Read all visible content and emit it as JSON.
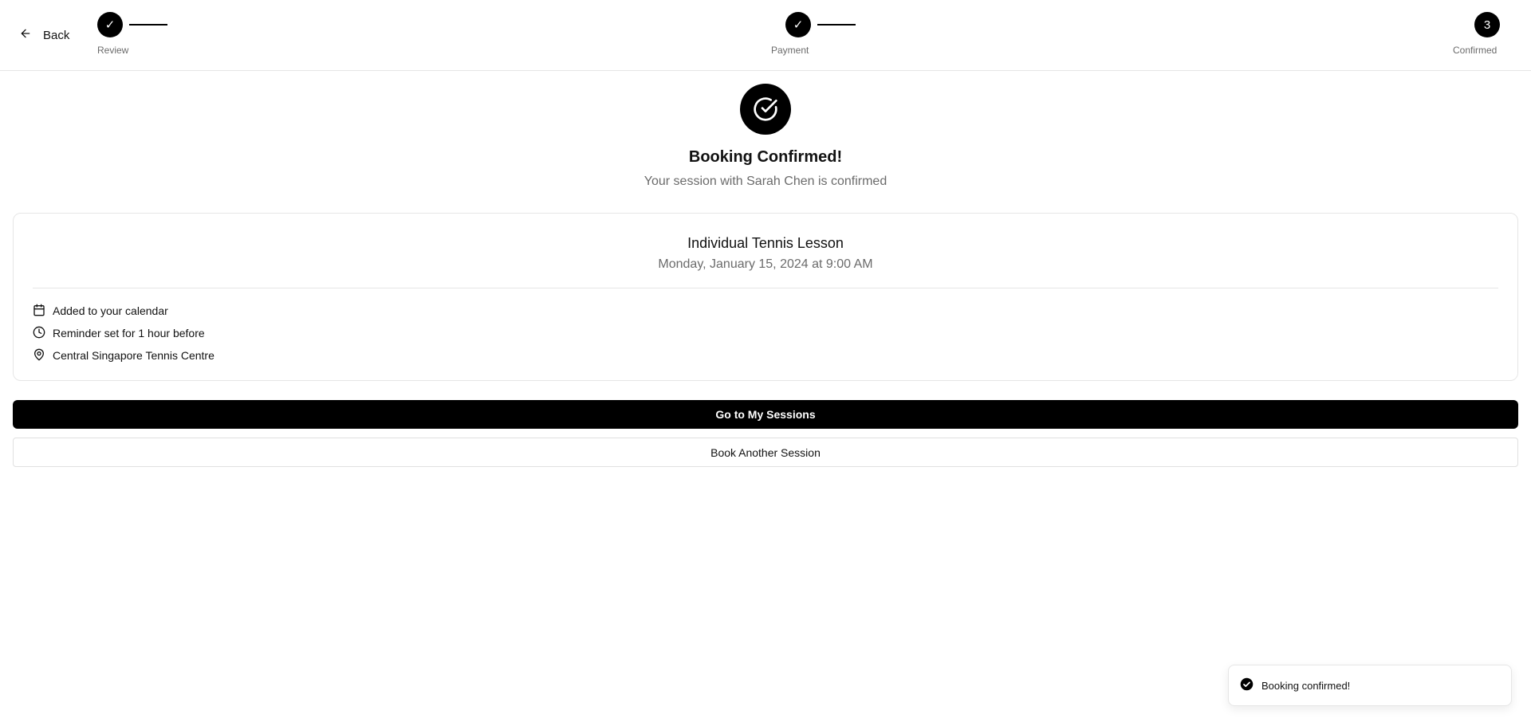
{
  "header": {
    "back_label": "Back",
    "back_icon": "arrow-left-icon",
    "steps": [
      {
        "label": "Review",
        "indicator": "✓",
        "status": "complete"
      },
      {
        "label": "Payment",
        "indicator": "✓",
        "status": "complete"
      },
      {
        "label": "Confirmed",
        "indicator": "3",
        "status": "current"
      }
    ]
  },
  "confirmation": {
    "icon": "circle-check-icon",
    "title": "Booking Confirmed!",
    "subtitle": "Your session with Sarah Chen is confirmed"
  },
  "details": {
    "lesson_title": "Individual Tennis Lesson",
    "datetime": "Monday, January 15, 2024 at 9:00 AM",
    "items": [
      {
        "icon": "calendar-icon",
        "text": "Added to your calendar"
      },
      {
        "icon": "clock-icon",
        "text": "Reminder set for 1 hour before"
      },
      {
        "icon": "map-pin-icon",
        "text": "Central Singapore Tennis Centre"
      }
    ]
  },
  "actions": {
    "primary_label": "Go to My Sessions",
    "secondary_label": "Book Another Session"
  },
  "toast": {
    "icon": "check-circle-filled-icon",
    "message": "Booking confirmed!"
  },
  "colors": {
    "accent": "#000000",
    "muted_text": "#6b6b6b",
    "border": "#e6e6e6"
  }
}
